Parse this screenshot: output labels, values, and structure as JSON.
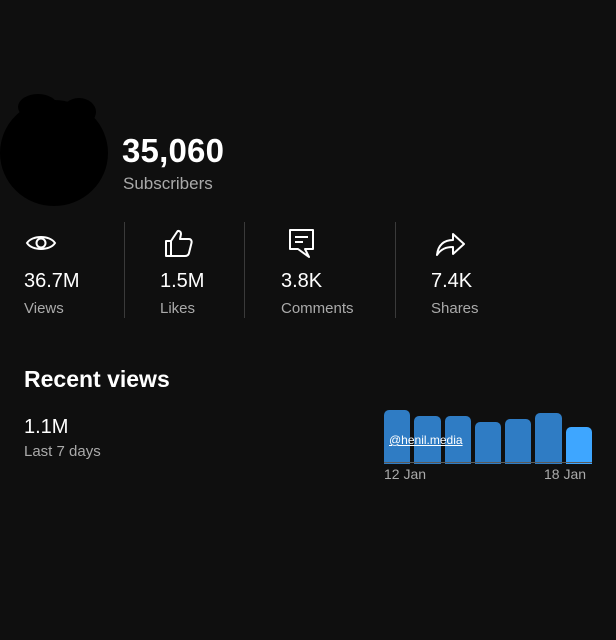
{
  "channel": {
    "subscriber_count": "35,060",
    "subscriber_label": "Subscribers"
  },
  "stats": [
    {
      "icon": "eye-icon",
      "value": "36.7M",
      "label": "Views"
    },
    {
      "icon": "thumbs-up-icon",
      "value": "1.5M",
      "label": "Likes"
    },
    {
      "icon": "comment-icon",
      "value": "3.8K",
      "label": "Comments"
    },
    {
      "icon": "share-arrow-icon",
      "value": "7.4K",
      "label": "Shares"
    }
  ],
  "recent": {
    "title": "Recent views",
    "value": "1.1M",
    "period": "Last 7 days",
    "watermark": "@henil.media",
    "date_start": "12 Jan",
    "date_end": "18 Jan"
  },
  "chart_data": {
    "type": "bar",
    "values": [
      100,
      88,
      88,
      77,
      83,
      95,
      68
    ],
    "ylim": [
      0,
      100
    ],
    "colors": {
      "bar": "#2f7cc4",
      "latest_bar": "#3ea6ff"
    }
  },
  "colors": {
    "background": "#0f0f0f",
    "text": "#ffffff",
    "muted_text": "#aaaaaa",
    "divider": "#3a3a3a"
  }
}
